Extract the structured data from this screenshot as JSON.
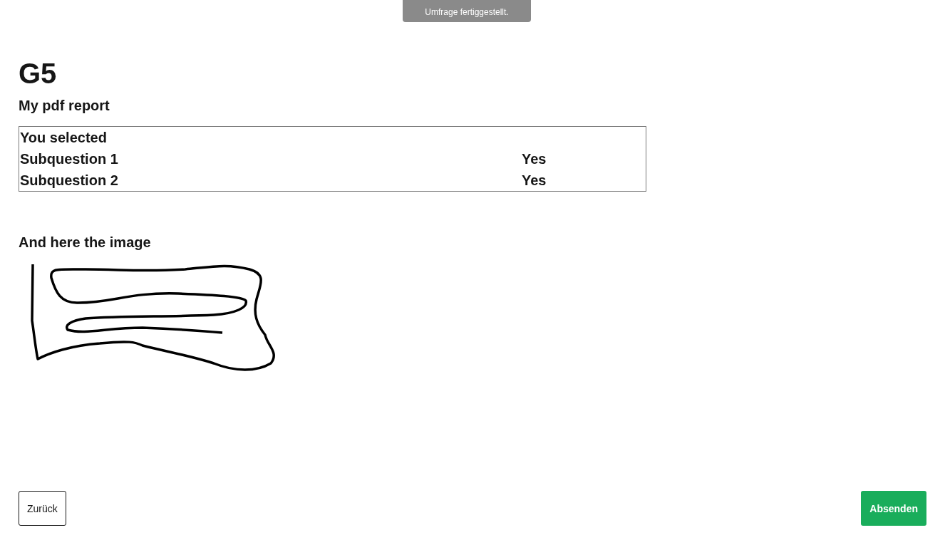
{
  "toast": {
    "text": "Umfrage fertiggestellt."
  },
  "title": "G5",
  "subtitle": "My pdf report",
  "table": {
    "header": "You selected",
    "rows": [
      {
        "label": "Subquestion 1",
        "value": "Yes"
      },
      {
        "label": "Subquestion 2",
        "value": "Yes"
      }
    ]
  },
  "image_heading": "And here the image",
  "buttons": [
    {
      "kind": "secondary",
      "label": "Zurück"
    },
    {
      "kind": "primary",
      "label": "Absenden"
    }
  ]
}
